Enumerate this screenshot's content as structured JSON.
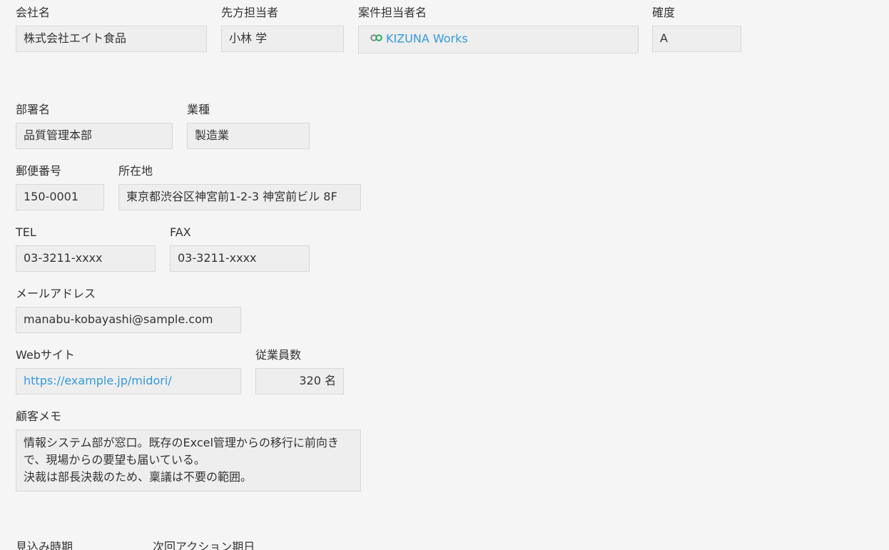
{
  "fields": {
    "company_name": {
      "label": "会社名",
      "value": "株式会社エイト食品"
    },
    "client_contact": {
      "label": "先方担当者",
      "value": "小林 学"
    },
    "case_owner": {
      "label": "案件担当者名",
      "value": "KIZUNA Works",
      "icon": "kizuna-user-icon"
    },
    "confidence": {
      "label": "確度",
      "value": "A"
    },
    "department": {
      "label": "部署名",
      "value": "品質管理本部"
    },
    "industry": {
      "label": "業種",
      "value": "製造業"
    },
    "postal_code": {
      "label": "郵便番号",
      "value": "150-0001"
    },
    "address": {
      "label": "所在地",
      "value": "東京都渋谷区神宮前1-2-3 神宮前ビル 8F"
    },
    "tel": {
      "label": "TEL",
      "value": "03-3211-xxxx"
    },
    "fax": {
      "label": "FAX",
      "value": "03-3211-xxxx"
    },
    "email": {
      "label": "メールアドレス",
      "value": "manabu-kobayashi@sample.com"
    },
    "website": {
      "label": "Webサイト",
      "value": "https://example.jp/midori/"
    },
    "employees": {
      "label": "従業員数",
      "value": "320 名"
    },
    "memo": {
      "label": "顧客メモ",
      "value": "情報システム部が窓口。既存のExcel管理からの移行に前向き\nで、現場からの要望も届いている。\n決裁は部長決裁のため、稟議は不要の範囲。"
    },
    "expected_period": {
      "label": "見込み時期"
    },
    "next_action_date": {
      "label": "次回アクション期日"
    }
  },
  "colors": {
    "background": "#f5f5f5",
    "field_bg": "#eeeeee",
    "field_border": "#d8d8d8",
    "link": "#3498db",
    "text": "#333333"
  }
}
